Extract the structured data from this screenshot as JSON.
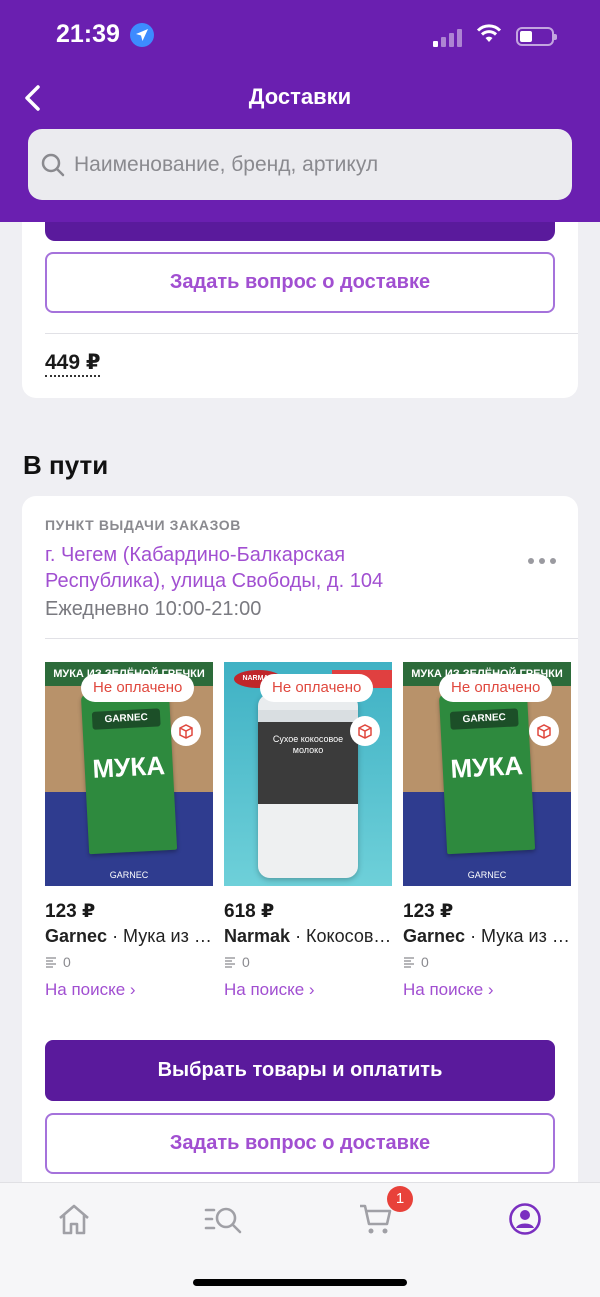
{
  "status_bar": {
    "time": "21:39",
    "battery_level": 0.4,
    "signal_bars_on": 1,
    "icons": [
      "location-arrow-icon",
      "signal-icon",
      "wifi-icon",
      "battery-icon"
    ]
  },
  "nav": {
    "title": "Доставки",
    "back_icon": "chevron-left-icon"
  },
  "search": {
    "placeholder": "Наименование, бренд, артикул",
    "value": ""
  },
  "delivery_prev": {
    "question_button": "Задать вопрос о доставке",
    "total": "449 ₽"
  },
  "in_transit": {
    "title": "В пути",
    "pickup_label": "ПУНКТ ВЫДАЧИ ЗАКАЗОВ",
    "address": "г. Чегем (Кабардино-Балкарская Республика), улица Свободы, д. 104",
    "hours": "Ежедневно 10:00-21:00",
    "products": [
      {
        "badge": "Не оплачено",
        "price": "123 ₽",
        "brand": "Garnec",
        "name": "· Мука из зелёной гречки",
        "count": "0",
        "status": "На поиске ›",
        "image": "flour",
        "band_text": "МУКА ИЗ ЗЕЛЁНОЙ ГРЕЧКИ",
        "pack_brand": "GARNEC",
        "pack_word": "МУКА",
        "logo_text": "GARNEC"
      },
      {
        "badge": "Не оплачено",
        "price": "618 ₽",
        "brand": "Narmak",
        "name": "· Кокосовое молоко",
        "count": "0",
        "status": "На поиске ›",
        "image": "coconut",
        "pack_brand": "NARMAK",
        "pack_label": "Сухое кокосовое молоко"
      },
      {
        "badge": "Не оплачено",
        "price": "123 ₽",
        "brand": "Garnec",
        "name": "· Мука из зелёной гречки",
        "count": "0",
        "status": "На поиске ›",
        "image": "flour",
        "band_text": "МУКА ИЗ ЗЕЛЁНОЙ ГРЕЧКИ",
        "pack_brand": "GARNEC",
        "pack_word": "МУКА",
        "logo_text": "GARNEC"
      }
    ],
    "pay_button": "Выбрать товары и оплатить",
    "question_button": "Задать вопрос о доставке"
  },
  "tabbar": {
    "tabs": [
      {
        "name": "home",
        "icon": "home-icon"
      },
      {
        "name": "catalog",
        "icon": "catalog-search-icon"
      },
      {
        "name": "cart",
        "icon": "cart-icon"
      },
      {
        "name": "profile",
        "icon": "profile-icon"
      }
    ],
    "cart_count": "1"
  },
  "colors": {
    "brand": "#6a1fb0",
    "primary_button": "#5a1a9c",
    "link": "#a14fd1",
    "unpaid": "#e0483e",
    "badge": "#e8413a"
  }
}
